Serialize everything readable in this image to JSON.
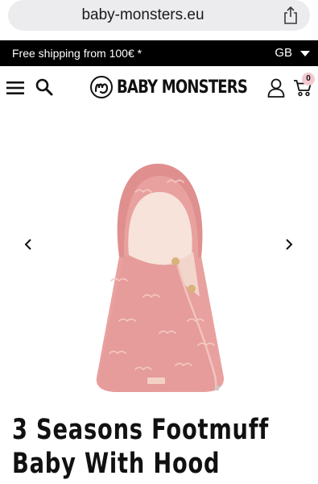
{
  "browser": {
    "url": "baby-monsters.eu",
    "share_icon": "share-icon"
  },
  "promo": {
    "text": "Free shipping from 100€ *",
    "language": "GB"
  },
  "header": {
    "brand": "BABY MONSTERS",
    "cart_count": "0",
    "icons": [
      "menu-icon",
      "search-icon",
      "user-icon",
      "cart-icon"
    ]
  },
  "product": {
    "title": "3 Seasons Footmuff Baby With Hood",
    "image_colors": {
      "fabric": "#e8a19f",
      "lining": "#f7e3d9",
      "buttons": "#d8b27a"
    }
  },
  "colors": {
    "promo_bg": "#000000",
    "badge": "#f3c9cf",
    "url_pill": "#ececee"
  }
}
